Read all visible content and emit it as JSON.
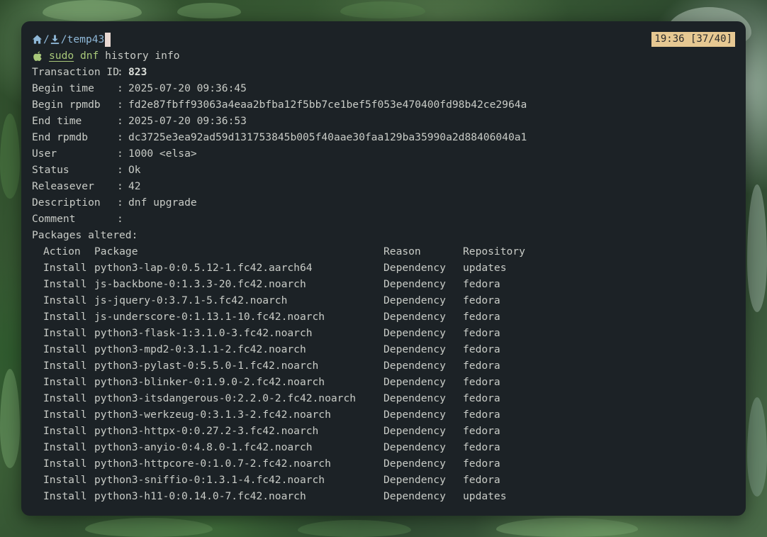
{
  "prompt": {
    "path": "/temp43",
    "clock": "19:36 [37/40]",
    "command": {
      "sudo": "sudo",
      "dnf": "dnf",
      "args": "history info"
    }
  },
  "info": [
    {
      "key": "Transaction ID",
      "value": "823",
      "bold": true
    },
    {
      "key": "Begin time",
      "value": "2025-07-20 09:36:45"
    },
    {
      "key": "Begin rpmdb",
      "value": "fd2e87fbff93063a4eaa2bfba12f5bb7ce1bef5f053e470400fd98b42ce2964a"
    },
    {
      "key": "End time",
      "value": "2025-07-20 09:36:53"
    },
    {
      "key": "End rpmdb",
      "value": "dc3725e3ea92ad59d131753845b005f40aae30faa129ba35990a2d88406040a1"
    },
    {
      "key": "User",
      "value": "1000 <elsa>"
    },
    {
      "key": "Status",
      "value": "Ok"
    },
    {
      "key": "Releasever",
      "value": "42"
    },
    {
      "key": "Description",
      "value": "dnf upgrade"
    },
    {
      "key": "Comment",
      "value": ""
    }
  ],
  "packages_label": "Packages altered:",
  "table": {
    "headers": {
      "action": "Action",
      "package": "Package",
      "reason": "Reason",
      "repository": "Repository"
    },
    "rows": [
      {
        "action": "Install",
        "package": "python3-lap-0:0.5.12-1.fc42.aarch64",
        "reason": "Dependency",
        "repository": "updates"
      },
      {
        "action": "Install",
        "package": "js-backbone-0:1.3.3-20.fc42.noarch",
        "reason": "Dependency",
        "repository": "fedora"
      },
      {
        "action": "Install",
        "package": "js-jquery-0:3.7.1-5.fc42.noarch",
        "reason": "Dependency",
        "repository": "fedora"
      },
      {
        "action": "Install",
        "package": "js-underscore-0:1.13.1-10.fc42.noarch",
        "reason": "Dependency",
        "repository": "fedora"
      },
      {
        "action": "Install",
        "package": "python3-flask-1:3.1.0-3.fc42.noarch",
        "reason": "Dependency",
        "repository": "fedora"
      },
      {
        "action": "Install",
        "package": "python3-mpd2-0:3.1.1-2.fc42.noarch",
        "reason": "Dependency",
        "repository": "fedora"
      },
      {
        "action": "Install",
        "package": "python3-pylast-0:5.5.0-1.fc42.noarch",
        "reason": "Dependency",
        "repository": "fedora"
      },
      {
        "action": "Install",
        "package": "python3-blinker-0:1.9.0-2.fc42.noarch",
        "reason": "Dependency",
        "repository": "fedora"
      },
      {
        "action": "Install",
        "package": "python3-itsdangerous-0:2.2.0-2.fc42.noarch",
        "reason": "Dependency",
        "repository": "fedora"
      },
      {
        "action": "Install",
        "package": "python3-werkzeug-0:3.1.3-2.fc42.noarch",
        "reason": "Dependency",
        "repository": "fedora"
      },
      {
        "action": "Install",
        "package": "python3-httpx-0:0.27.2-3.fc42.noarch",
        "reason": "Dependency",
        "repository": "fedora"
      },
      {
        "action": "Install",
        "package": "python3-anyio-0:4.8.0-1.fc42.noarch",
        "reason": "Dependency",
        "repository": "fedora"
      },
      {
        "action": "Install",
        "package": "python3-httpcore-0:1.0.7-2.fc42.noarch",
        "reason": "Dependency",
        "repository": "fedora"
      },
      {
        "action": "Install",
        "package": "python3-sniffio-0:1.3.1-4.fc42.noarch",
        "reason": "Dependency",
        "repository": "fedora"
      },
      {
        "action": "Install",
        "package": "python3-h11-0:0.14.0-7.fc42.noarch",
        "reason": "Dependency",
        "repository": "updates"
      }
    ]
  },
  "colors": {
    "terminal_bg": "#1c2226",
    "text": "#c9ccc7",
    "path": "#8fb8d8",
    "command": "#a9c97a",
    "clock_bg": "#e6c892"
  },
  "icons": [
    "home-icon",
    "download-icon",
    "apple-icon"
  ]
}
